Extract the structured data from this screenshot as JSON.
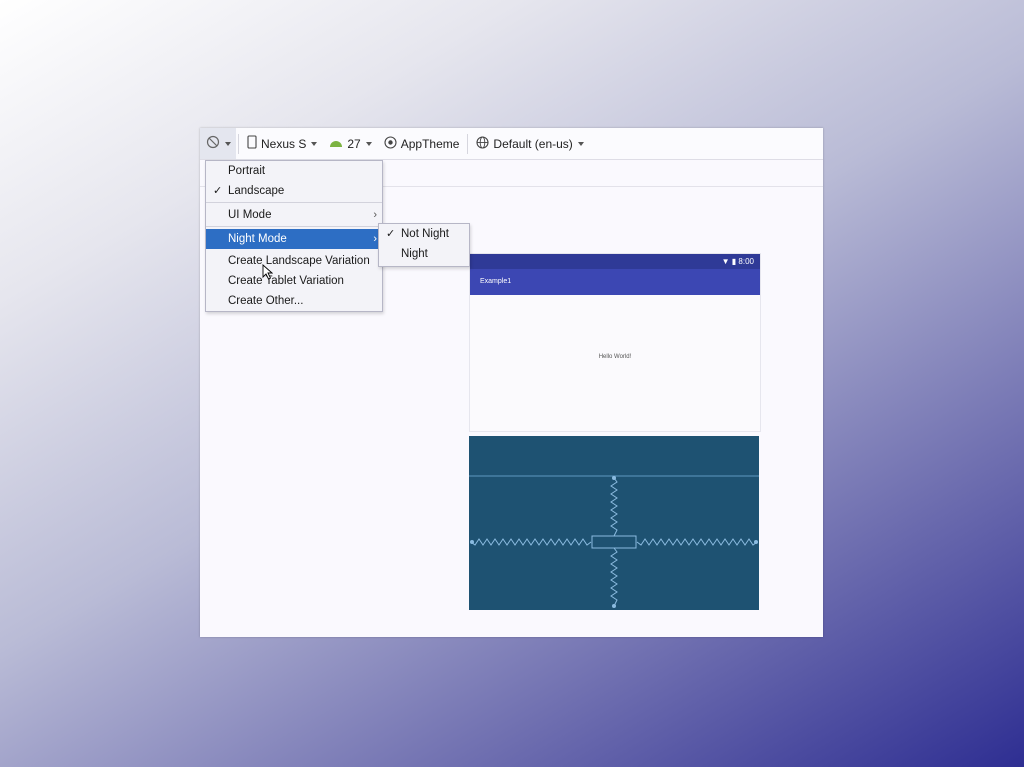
{
  "toolbar": {
    "orientation_icon": "rotate-orientation-icon",
    "device": "Nexus S",
    "api_level": "27",
    "theme": "AppTheme",
    "locale": "Default (en-us)"
  },
  "menu": {
    "items": [
      {
        "label": "Portrait",
        "checked": false
      },
      {
        "label": "Landscape",
        "checked": true
      },
      {
        "label": "UI Mode"
      },
      {
        "label": "Night Mode"
      },
      {
        "label": "Create Landscape Variation"
      },
      {
        "label": "Create Tablet Variation"
      },
      {
        "label": "Create Other..."
      }
    ],
    "check_glyph": "✓",
    "submenu_arrow": "›"
  },
  "submenu": {
    "items": [
      {
        "label": "Not Night",
        "checked": true
      },
      {
        "label": "Night",
        "checked": false
      }
    ]
  },
  "preview": {
    "status_time": "8:00",
    "app_title": "Example1",
    "body_text": "Hello World!",
    "accent": "#3c47b3",
    "status_color": "#2f3a97",
    "blueprint_color": "#1e5272"
  }
}
